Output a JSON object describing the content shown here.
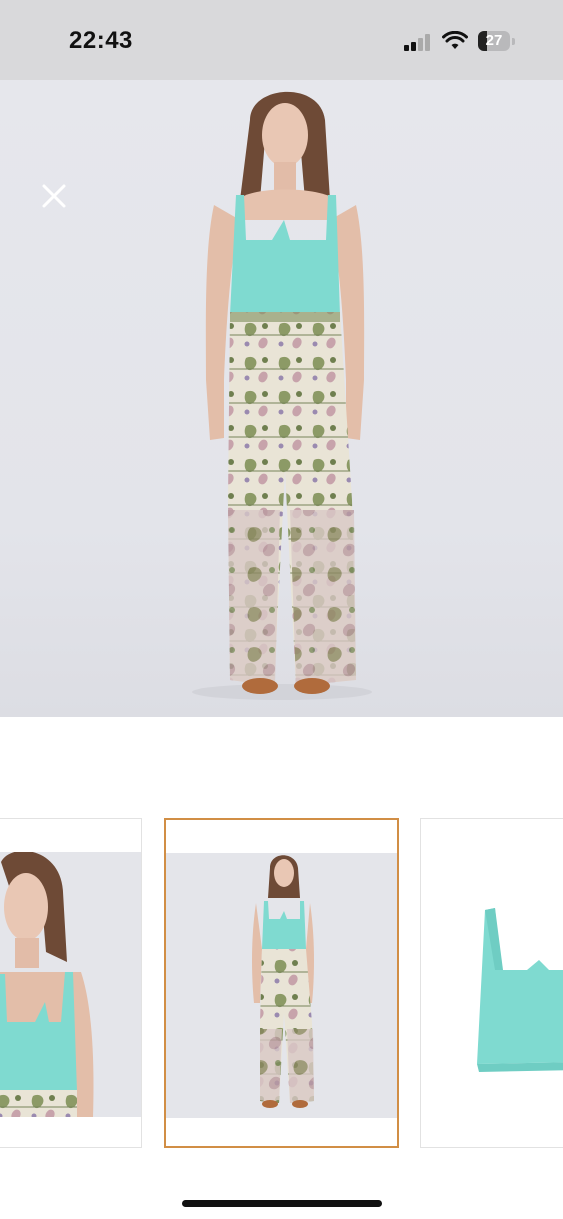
{
  "status_bar": {
    "time": "22:43",
    "battery_level": "27",
    "battery_fraction": 0.27,
    "icons": [
      "signal-icon",
      "wifi-icon",
      "battery-icon"
    ]
  },
  "viewer": {
    "close_icon": "close-icon",
    "main_image": {
      "subject": "model-photo",
      "colors": {
        "top": "#7fdad0",
        "pants_base": "#e7e2d4",
        "pants_pattern": "#7f8f5c",
        "pants_accent": "#c9a6ae",
        "skin": "#e7c4b0",
        "hair": "#6e4a36",
        "sandals": "#b06b3c"
      }
    },
    "thumbnails": [
      {
        "subject": "model-crop-left",
        "selected": false
      },
      {
        "subject": "model-full-body",
        "selected": true
      },
      {
        "subject": "product-top-only",
        "selected": false
      }
    ],
    "selected_border_color": "#d18e45"
  }
}
